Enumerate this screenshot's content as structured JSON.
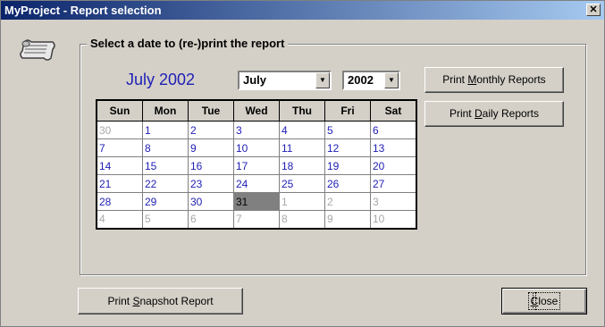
{
  "window": {
    "title": "MyProject - Report selection",
    "close_glyph": "✕"
  },
  "group": {
    "title": "Select a date to (re-)print the report"
  },
  "calendar": {
    "heading": "July 2002",
    "month_value": "July",
    "year_value": "2002",
    "weekdays": [
      "Sun",
      "Mon",
      "Tue",
      "Wed",
      "Thu",
      "Fri",
      "Sat"
    ],
    "weeks": [
      [
        {
          "d": "30",
          "out": true
        },
        {
          "d": "1"
        },
        {
          "d": "2"
        },
        {
          "d": "3"
        },
        {
          "d": "4"
        },
        {
          "d": "5"
        },
        {
          "d": "6"
        }
      ],
      [
        {
          "d": "7"
        },
        {
          "d": "8"
        },
        {
          "d": "9"
        },
        {
          "d": "10"
        },
        {
          "d": "11"
        },
        {
          "d": "12"
        },
        {
          "d": "13"
        }
      ],
      [
        {
          "d": "14"
        },
        {
          "d": "15"
        },
        {
          "d": "16"
        },
        {
          "d": "17"
        },
        {
          "d": "18"
        },
        {
          "d": "19"
        },
        {
          "d": "20"
        }
      ],
      [
        {
          "d": "21"
        },
        {
          "d": "22"
        },
        {
          "d": "23"
        },
        {
          "d": "24"
        },
        {
          "d": "25"
        },
        {
          "d": "26"
        },
        {
          "d": "27"
        }
      ],
      [
        {
          "d": "28"
        },
        {
          "d": "29"
        },
        {
          "d": "30"
        },
        {
          "d": "31",
          "sel": true
        },
        {
          "d": "1",
          "out": true
        },
        {
          "d": "2",
          "out": true
        },
        {
          "d": "3",
          "out": true
        }
      ],
      [
        {
          "d": "4",
          "out": true
        },
        {
          "d": "5",
          "out": true
        },
        {
          "d": "6",
          "out": true
        },
        {
          "d": "7",
          "out": true
        },
        {
          "d": "8",
          "out": true
        },
        {
          "d": "9",
          "out": true
        },
        {
          "d": "10",
          "out": true
        }
      ]
    ]
  },
  "buttons": {
    "monthly": {
      "pre": "Print ",
      "acc": "M",
      "post": "onthly Reports"
    },
    "daily": {
      "pre": "Print ",
      "acc": "D",
      "post": "aily Reports"
    },
    "snapshot": {
      "pre": "Print ",
      "acc": "S",
      "post": "napshot Report"
    },
    "close": {
      "pre": "",
      "acc": "C",
      "post": "lose"
    }
  },
  "icons": {
    "report": "scroll-icon",
    "dropdown": "▼"
  }
}
